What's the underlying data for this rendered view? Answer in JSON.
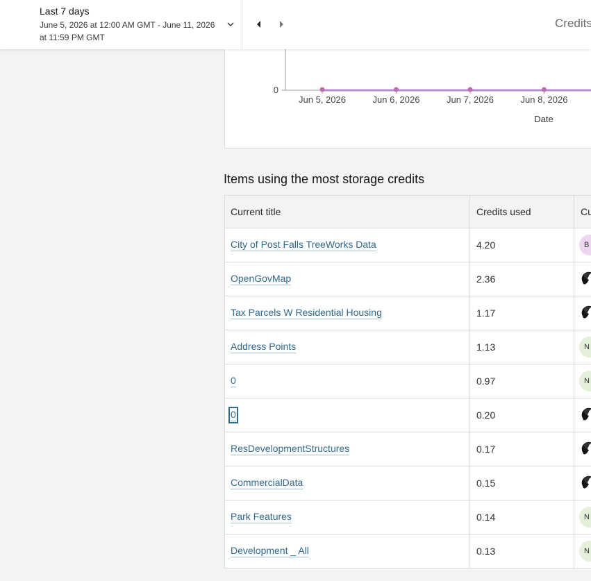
{
  "header": {
    "range_label": "Last 7 days",
    "range_detail": "June 5, 2026 at 12:00 AM GMT - June 11, 2026 at 11:59 PM GMT",
    "active_tab": "Credits"
  },
  "chart_data": {
    "type": "line",
    "x": [
      "Jun 5, 2026",
      "Jun 6, 2026",
      "Jun 7, 2026",
      "Jun 8, 2026"
    ],
    "series": [
      {
        "values": [
          0,
          0,
          0,
          0
        ],
        "color": "#c069b8"
      }
    ],
    "xlabel": "Date",
    "y_ticks": [
      "0"
    ]
  },
  "items_section": {
    "title": "Items using the most storage credits",
    "columns": [
      "Current title",
      "Credits used",
      "Cu"
    ],
    "rows": [
      {
        "title": "City of Post Falls TreeWorks Data",
        "credits": "4.20",
        "owner_initial": "B",
        "owner_style": "pink"
      },
      {
        "title": "OpenGovMap",
        "credits": "2.36",
        "owner_initial": "",
        "owner_style": "photo"
      },
      {
        "title": "Tax Parcels W Residential Housing",
        "credits": "1.17",
        "owner_initial": "",
        "owner_style": "photo"
      },
      {
        "title": "Address Points",
        "credits": "1.13",
        "owner_initial": "N",
        "owner_style": "green"
      },
      {
        "title": "0",
        "credits": "0.97",
        "owner_initial": "N",
        "owner_style": "green"
      },
      {
        "title": "0",
        "credits": "0.20",
        "owner_initial": "",
        "owner_style": "photo",
        "focused": true
      },
      {
        "title": "ResDevelopmentStructures",
        "credits": "0.17",
        "owner_initial": "",
        "owner_style": "photo"
      },
      {
        "title": "CommercialData",
        "credits": "0.15",
        "owner_initial": "",
        "owner_style": "photo"
      },
      {
        "title": "Park Features",
        "credits": "0.14",
        "owner_initial": "N",
        "owner_style": "green"
      },
      {
        "title": "Development _ All",
        "credits": "0.13",
        "owner_initial": "N",
        "owner_style": "green"
      }
    ]
  }
}
